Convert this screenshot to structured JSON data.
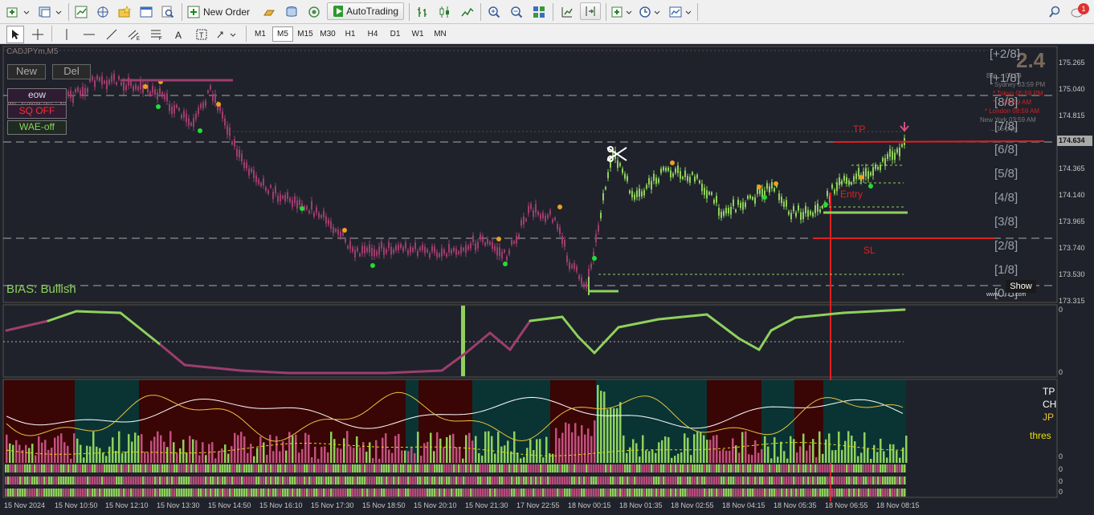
{
  "toolbar": {
    "new_order_label": "New Order",
    "autotrading_label": "AutoTrading",
    "notification_count": "1",
    "timeframes": [
      "M1",
      "M5",
      "M15",
      "M30",
      "H1",
      "H4",
      "D1",
      "W1",
      "MN"
    ],
    "active_timeframe": "M5"
  },
  "chart": {
    "symbol_title": "CADJPYm,M5",
    "buttons": {
      "new": "New",
      "del": "Del",
      "eow": "eow",
      "sq_off": "SQ OFF",
      "wae_off": "WAE-off"
    },
    "bias_label": "BIAS: Bullish",
    "big_value": "2.4",
    "info_lines": [
      "Bar ... 00:09",
      "Sydney 03:59 PM",
      "* Tokyo 05:59 PM",
      "* ... 09:59 AM",
      "* London 08:59 AM",
      "New York 03:59 AM",
      "... 15 pips"
    ],
    "murray_levels": [
      "[+2/8]",
      "[+1/8]",
      "[8/8]",
      "[7/8]",
      "[6/8]",
      "[5/8]",
      "[4/8]",
      "[3/8]",
      "[2/8]",
      "[1/8]",
      "[0/8]"
    ],
    "tp_label": "TP",
    "entry_label": "Entry",
    "sl_label": "SL",
    "show_button": "Show",
    "watermark": "www...........com",
    "price_ticks": [
      "175.265",
      "175.040",
      "174.815",
      "174.590",
      "174.365",
      "174.140",
      "173.965",
      "173.740",
      "173.530",
      "173.315"
    ],
    "current_price": "174.634",
    "indicator1_ticks": [
      "0",
      "0"
    ],
    "indicator2_legend": [
      "TP",
      "CH",
      "JP",
      "thres"
    ],
    "indicator2_ticks": [
      "0",
      "0",
      "0",
      "0"
    ],
    "time_labels": [
      "15 Nov 2024",
      "15 Nov 10:50",
      "15 Nov 12:10",
      "15 Nov 13:30",
      "15 Nov 14:50",
      "15 Nov 16:10",
      "15 Nov 17:30",
      "15 Nov 18:50",
      "15 Nov 20:10",
      "15 Nov 21:30",
      "17 Nov 22:55",
      "18 Nov 00:15",
      "18 Nov 01:35",
      "18 Nov 02:55",
      "18 Nov 04:15",
      "18 Nov 05:35",
      "18 Nov 06:55",
      "18 Nov 08:15"
    ]
  },
  "colors": {
    "bear": "#9e3d6e",
    "bull": "#8fd15c",
    "level_red": "#e02020",
    "dot_orange": "#f0a020",
    "dot_green": "#22dd33",
    "chart_bg": "#1f222b"
  }
}
